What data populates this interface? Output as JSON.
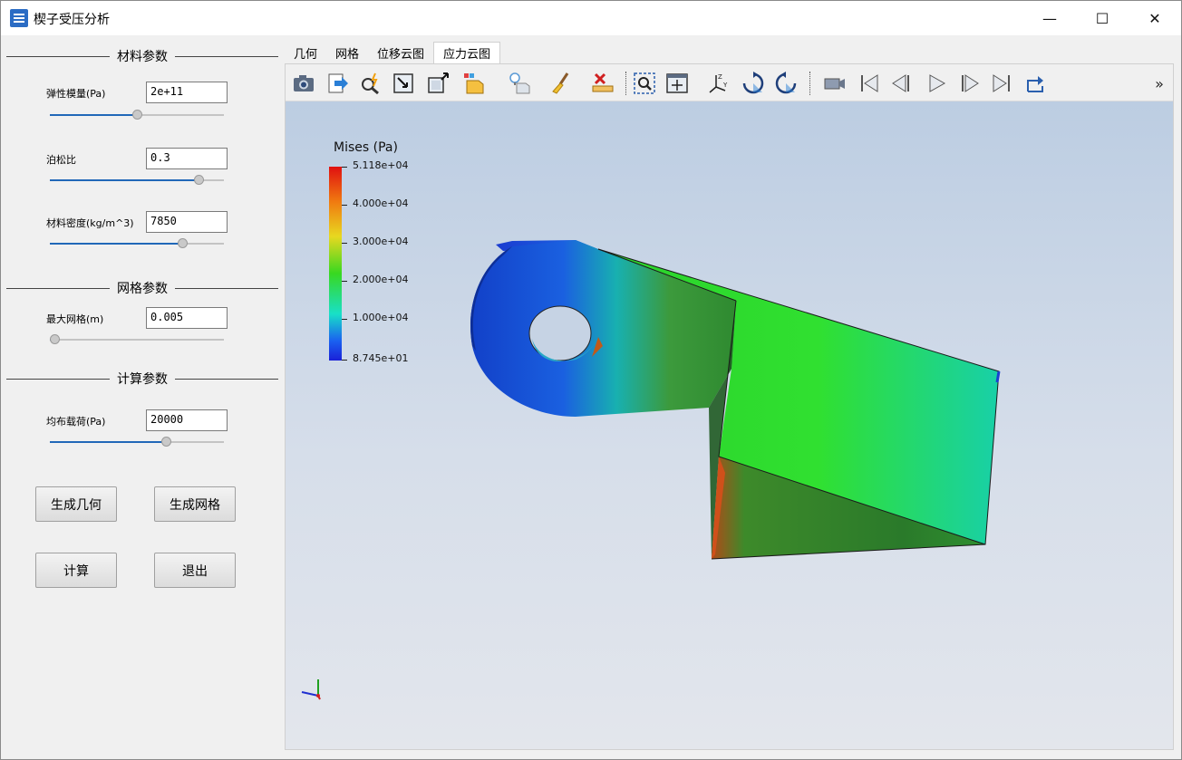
{
  "window": {
    "title": "楔子受压分析",
    "minimize": "—",
    "maximize": "☐",
    "close": "✕"
  },
  "material": {
    "heading": "材料参数",
    "youngs_label": "弹性模量(Pa)",
    "youngs_value": "2e+11",
    "youngs_slider": 0.5,
    "poisson_label": "泊松比",
    "poisson_value": "0.3",
    "poisson_slider": 0.88,
    "density_label": "材料密度(kg/m^3)",
    "density_value": "7850",
    "density_slider": 0.78
  },
  "mesh": {
    "heading": "网格参数",
    "maxsize_label": "最大网格(m)",
    "maxsize_value": "0.005",
    "maxsize_slider": 0.0
  },
  "compute": {
    "heading": "计算参数",
    "load_label": "均布载荷(Pa)",
    "load_value": "20000",
    "load_slider": 0.68
  },
  "buttons": {
    "gen_geometry": "生成几何",
    "gen_mesh": "生成网格",
    "compute": "计算",
    "exit": "退出"
  },
  "tabs": [
    "几何",
    "网格",
    "位移云图",
    "应力云图"
  ],
  "active_tab": "应力云图",
  "toolbar": {
    "overflow": "»",
    "icons": [
      "camera-icon",
      "export-icon",
      "magic-zoom-icon",
      "reset-view-icon",
      "maximize-view-icon",
      "representation-icon",
      "light-icon",
      "clear-icon",
      "delete-icon",
      "zoom-box-icon",
      "fit-view-icon",
      "axes-orientation-icon",
      "rotate-cw-icon",
      "rotate-ccw-icon",
      "video-icon",
      "first-frame-icon",
      "prev-frame-icon",
      "play-icon",
      "next-frame-icon",
      "last-frame-icon",
      "loop-icon"
    ]
  },
  "legend": {
    "title": "Mises (Pa)",
    "ticks": [
      "5.118e+04",
      "4.000e+04",
      "3.000e+04",
      "2.000e+04",
      "1.000e+04",
      "8.745e+01"
    ]
  },
  "colors": {
    "accent": "#2168b8",
    "high_stress": "#e01010",
    "low_stress": "#1a20d8"
  }
}
